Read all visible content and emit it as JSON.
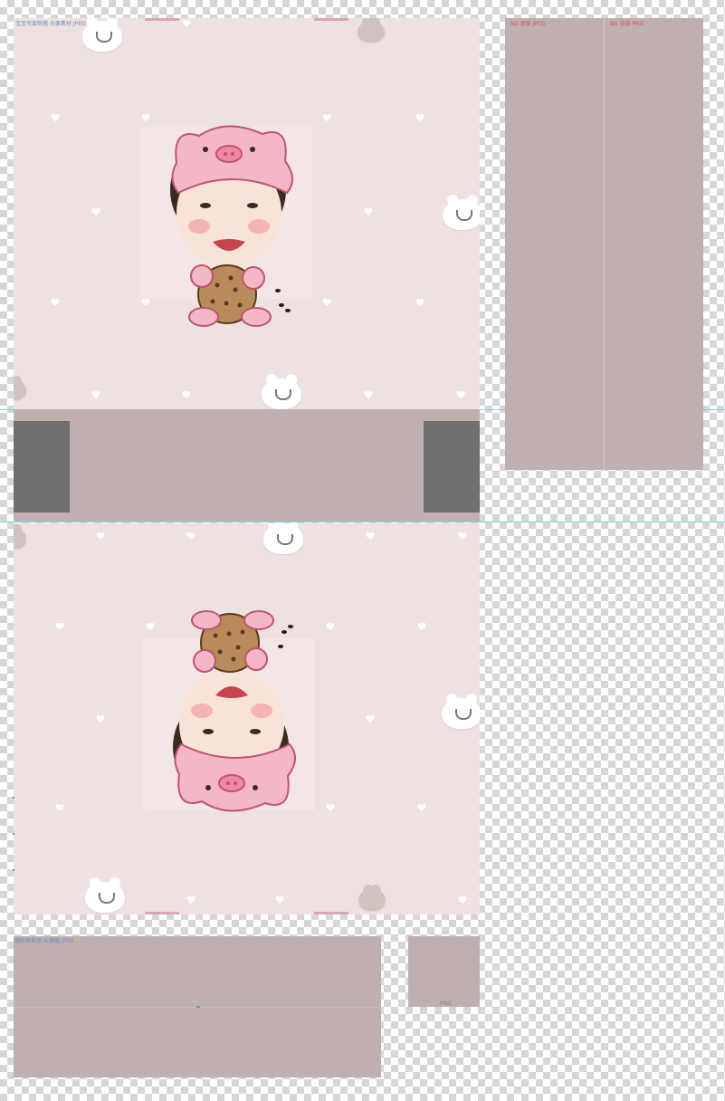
{
  "canvas": {
    "top_panel_label": "宝宝可爱粉猪 头像素材 JPEG",
    "right_panel_labels": [
      "BG 竖版 JPEG",
      "BG 竖版 PNG"
    ],
    "bottom_left_label": "横版背景图 长横幅 JPEG",
    "bottom_right_label": "PNG"
  },
  "colors": {
    "canvas_panel": "#eee2e1",
    "mauve_block": "#bfb0af",
    "dark_block": "#6f6f6f",
    "guide_line": "#7fd4e6",
    "pig_pink": "#f4b7c8",
    "cookie": "#b98a5a"
  },
  "icons": {
    "heart": "heart-icon",
    "bear": "bear-face-icon",
    "pig": "pig-hat-sticker",
    "cookie": "cookie-sticker"
  }
}
